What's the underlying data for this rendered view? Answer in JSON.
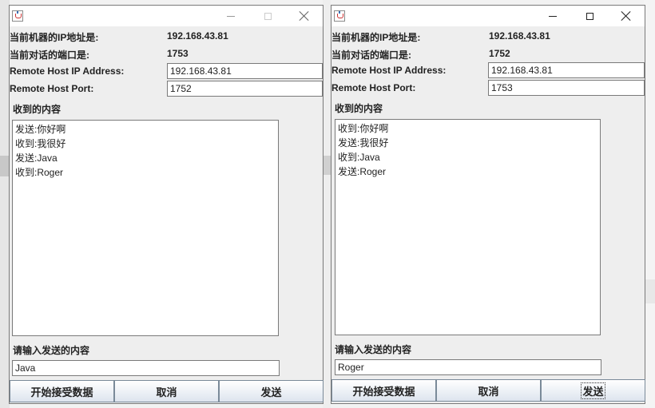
{
  "windows": [
    {
      "local_ip_label": "当前机器的IP地址是:",
      "local_ip_value": "192.168.43.81",
      "local_port_label": "当前对话的端口是:",
      "local_port_value": "1753",
      "remote_ip_label": "Remote Host IP Address:",
      "remote_ip_value": "192.168.43.81",
      "remote_port_label": "Remote Host Port:",
      "remote_port_value": "1752",
      "received_label": "收到的内容",
      "messages": [
        "发送:你好啊",
        "收到:我很好",
        "发送:Java",
        "收到:Roger"
      ],
      "input_label": "请输入发送的内容",
      "input_value": "Java",
      "buttons": {
        "start": "开始接受数据",
        "cancel": "取消",
        "send": "发送"
      }
    },
    {
      "local_ip_label": "当前机器的IP地址是:",
      "local_ip_value": "192.168.43.81",
      "local_port_label": "当前对话的端口是:",
      "local_port_value": "1752",
      "remote_ip_label": "Remote Host IP Address:",
      "remote_ip_value": "192.168.43.81",
      "remote_port_label": "Remote Host Port:",
      "remote_port_value": "1753",
      "received_label": "收到的内容",
      "messages": [
        "收到:你好啊",
        "发送:我很好",
        "收到:Java",
        "发送:Roger"
      ],
      "input_label": "请输入发送的内容",
      "input_value": "Roger",
      "buttons": {
        "start": "开始接受数据",
        "cancel": "取消",
        "send": "发送"
      }
    }
  ]
}
